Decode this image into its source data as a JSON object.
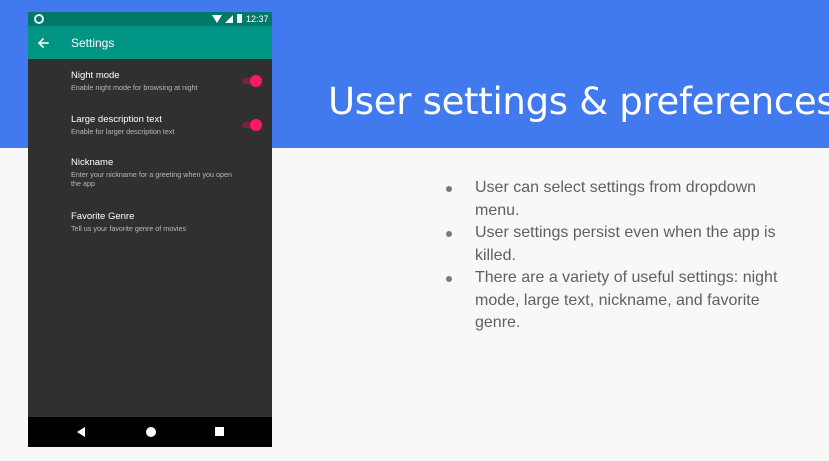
{
  "slide": {
    "title": "User settings & preferences",
    "bullets": [
      "User can select settings from dropdown menu.",
      "User settings persist even when the app is killed.",
      "There are a variety of useful settings: night mode, large text, nickname, and favorite genre."
    ]
  },
  "colors": {
    "header_band": "#4179ee",
    "app_bar": "#009485",
    "status_bar": "#00796b",
    "screen_background": "#303030",
    "toggle_accent": "#ff1a5c"
  },
  "phone": {
    "status_bar": {
      "time": "12:37",
      "icons": [
        "notification-circle-icon",
        "wifi-icon",
        "signal-icon",
        "battery-icon"
      ]
    },
    "app_bar": {
      "back_icon": "arrow-back-icon",
      "title": "Settings"
    },
    "settings": [
      {
        "title": "Night mode",
        "summary": "Enable night mode for browsing at night",
        "toggle": true,
        "checked": true
      },
      {
        "title": "Large description text",
        "summary": "Enable for larger description text",
        "toggle": true,
        "checked": true
      },
      {
        "title": "Nickname",
        "summary": "Enter your nickname for a greeting when you open the app",
        "toggle": false
      },
      {
        "title": "Favorite Genre",
        "summary": "Tell us your favorite genre of movies",
        "toggle": false
      }
    ],
    "nav_bar": {
      "icons": [
        "nav-back-icon",
        "nav-home-icon",
        "nav-recents-icon"
      ]
    }
  }
}
